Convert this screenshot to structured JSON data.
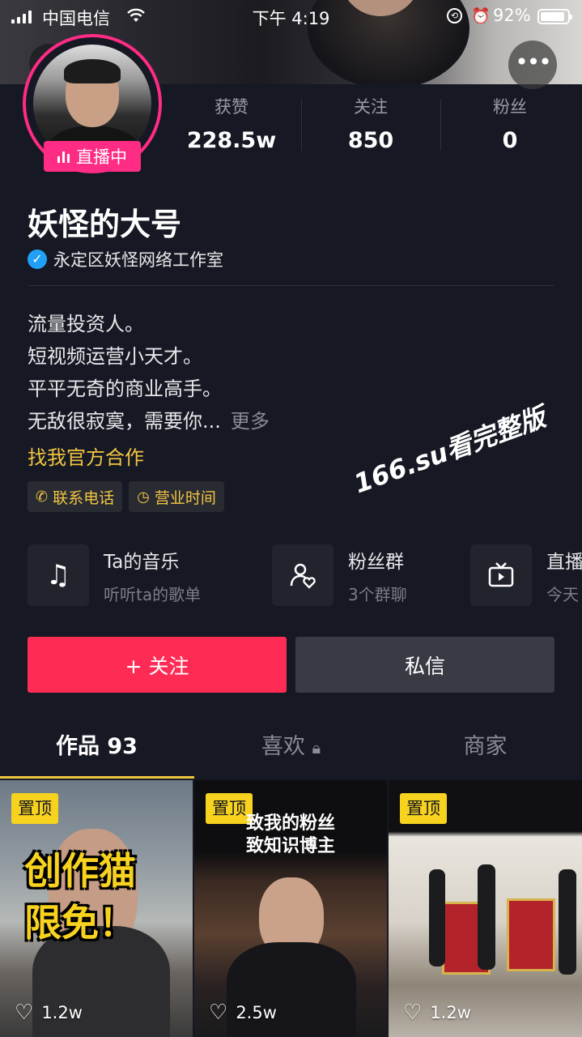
{
  "status_bar": {
    "carrier": "中国电信",
    "time": "下午 4:19",
    "battery": "92%",
    "battery_level": 0.92
  },
  "profile": {
    "live_label": "直播中",
    "stats": [
      {
        "label": "获赞",
        "value": "228.5w"
      },
      {
        "label": "关注",
        "value": "850"
      },
      {
        "label": "粉丝",
        "value": "0"
      }
    ],
    "nickname": "妖怪的大号",
    "verified_org": "永定区妖怪网络工作室",
    "bio_lines": [
      "流量投资人。",
      "短视频运营小天才。",
      "平平无奇的商业高手。",
      "无敌很寂寞，需要你..."
    ],
    "bio_more": "更多",
    "cooperate": "找我官方合作",
    "chips": [
      {
        "icon": "phone-icon",
        "label": "联系电话"
      },
      {
        "icon": "clock-icon",
        "label": "营业时间"
      }
    ]
  },
  "watermark": "166.su看完整版",
  "features": [
    {
      "icon": "music-note-icon",
      "title": "Ta的音乐",
      "subtitle": "听听ta的歌单"
    },
    {
      "icon": "fan-group-icon",
      "title": "粉丝群",
      "subtitle": "3个群聊"
    },
    {
      "icon": "tv-icon",
      "title": "直播",
      "subtitle": "今天"
    }
  ],
  "actions": {
    "follow": "+ 关注",
    "message": "私信"
  },
  "tabs": [
    {
      "label": "作品 93",
      "active": true
    },
    {
      "label": "喜欢",
      "locked": true
    },
    {
      "label": "商家"
    }
  ],
  "videos": [
    {
      "pinned": "置顶",
      "caption_lines": [
        "创作猫",
        "限免！"
      ],
      "likes": "1.2w"
    },
    {
      "pinned": "置顶",
      "caption_lines": [
        "致我的粉丝",
        "致知识博主"
      ],
      "likes": "2.5w"
    },
    {
      "pinned": "置顶",
      "caption_lines": [],
      "likes": "1.2w"
    }
  ],
  "colors": {
    "background": "#161823",
    "follow_button": "#fe2c55",
    "live_badge": "#fe2c84",
    "accent_yellow": "#f2c542"
  }
}
